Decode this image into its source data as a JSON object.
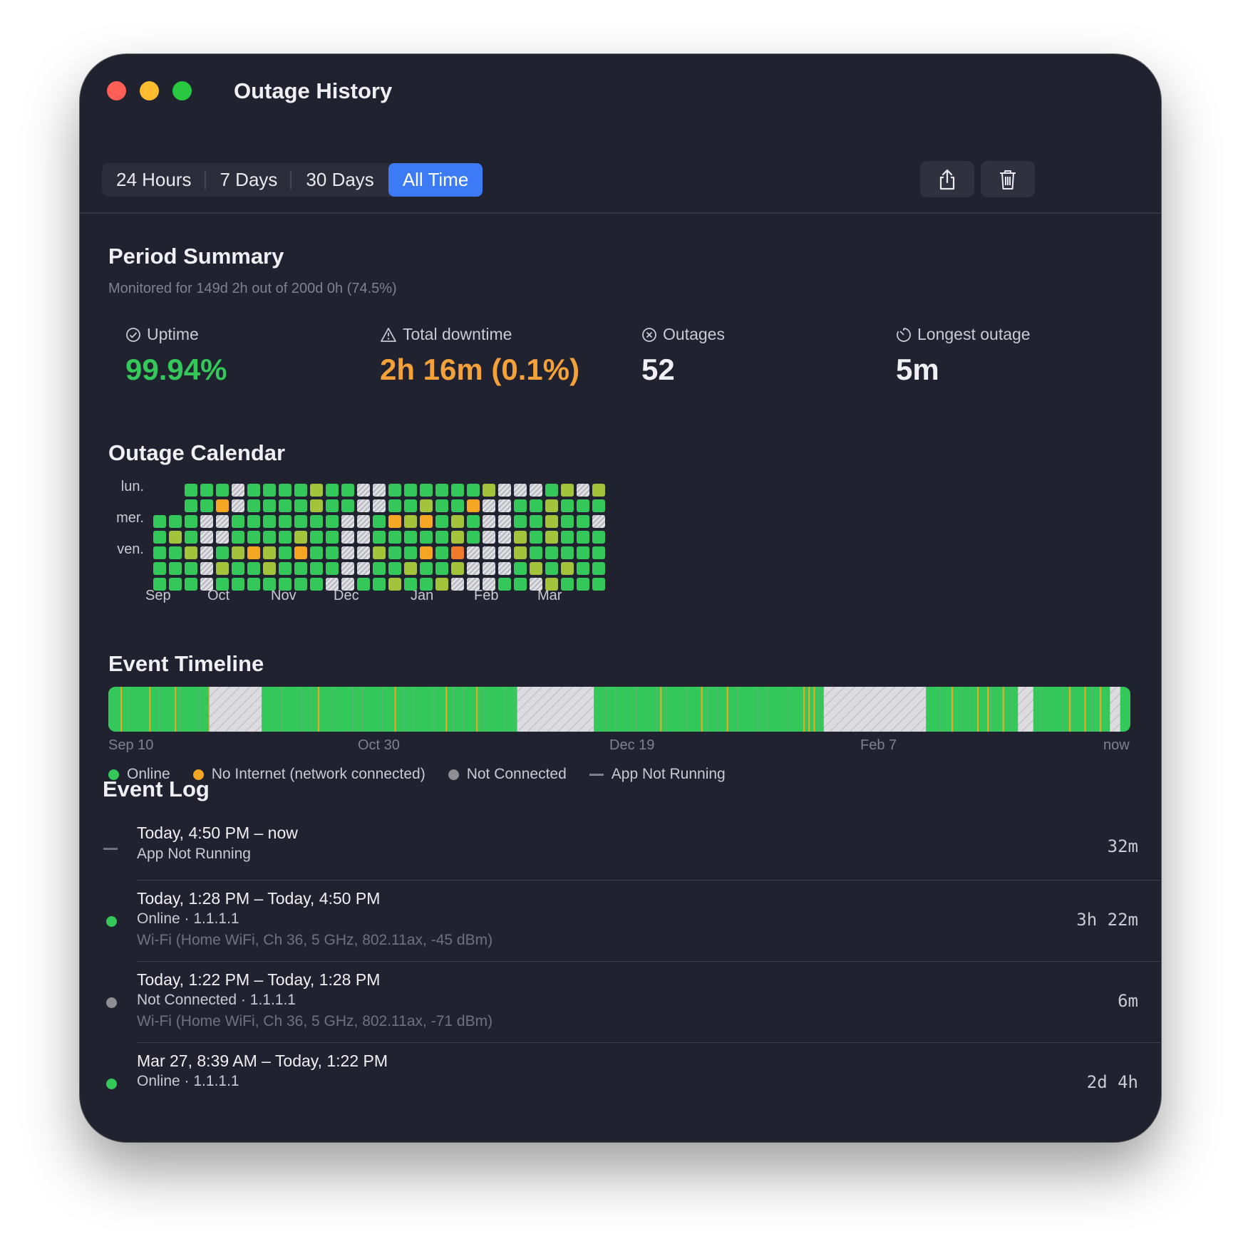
{
  "window": {
    "title": "Outage History"
  },
  "toolbar": {
    "tabs": [
      "24 Hours",
      "7 Days",
      "30 Days",
      "All Time"
    ],
    "active_tab": "All Time",
    "share_icon": "share-icon",
    "trash_icon": "trash-icon"
  },
  "summary": {
    "heading": "Period Summary",
    "monitored": "Monitored for 149d 2h out of 200d 0h (74.5%)",
    "uptime_label": "Uptime",
    "uptime_value": "99.94%",
    "downtime_label": "Total downtime",
    "downtime_value": "2h 16m (0.1%)",
    "outages_label": "Outages",
    "outages_value": "52",
    "longest_label": "Longest outage",
    "longest_value": "5m"
  },
  "calendar": {
    "heading": "Outage Calendar",
    "day_labels": [
      "lun.",
      "mer.",
      "ven."
    ],
    "months": [
      "Sep",
      "Oct",
      "Nov",
      "Dec",
      "Jan",
      "Feb",
      "Mar"
    ],
    "rows": [
      "..GGGWGGGGLGGWWGGGGGGLWWWGLWL",
      "..GGOWGGGGLGGWWGGLGGOWWGGLGGG",
      "GGGWWGGGGGGGWWGOLOGLGWWGGLGGW",
      "GLGWWGGGGLGGWWGGGGGLGWWLGLGGG",
      "GGLWGLOLGOGGWWLGGOGDWWWLGGGGG",
      "GGGWLGGLGGGGWWGGLGGLWWWGLGLGG",
      "GGGWGGGGGGGWWGGLGGLWWWGGWLGGG"
    ],
    "colors": {
      "G": "#34c759",
      "L": "#a3c33a",
      "O": "#f5a623",
      "D": "#f07a2a",
      "W": "#d8d8dc"
    }
  },
  "timeline": {
    "heading": "Event Timeline",
    "axis": [
      "Sep 10",
      "Oct 30",
      "Dec 19",
      "Feb 7",
      "now"
    ],
    "gaps": [
      [
        0.099,
        0.15
      ],
      [
        0.4,
        0.475
      ],
      [
        0.7,
        0.8
      ],
      [
        0.89,
        0.905
      ],
      [
        0.98,
        0.99
      ]
    ],
    "orange_ticks": [
      0.012,
      0.04,
      0.065,
      0.098,
      0.205,
      0.28,
      0.33,
      0.36,
      0.44,
      0.54,
      0.58,
      0.605,
      0.68,
      0.685,
      0.69,
      0.825,
      0.85,
      0.86,
      0.875,
      0.94,
      0.955,
      0.97
    ]
  },
  "legend": {
    "online": "Online",
    "no_internet": "No Internet (network connected)",
    "not_connected": "Not Connected",
    "app_not_running": "App Not Running",
    "online_color": "#34c759",
    "no_internet_color": "#f5a623",
    "not_connected_color": "#8e8e93"
  },
  "log": {
    "heading": "Event Log",
    "events": [
      {
        "title": "Today, 4:50 PM – now",
        "status": "App Not Running",
        "target": "",
        "network": "",
        "duration": "32m"
      },
      {
        "title": "Today, 1:28 PM – Today, 4:50 PM",
        "status": "Online",
        "target": "1.1.1.1",
        "network": "Wi-Fi (Home WiFi, Ch 36, 5 GHz, 802.11ax, -45 dBm)",
        "duration": "3h 22m"
      },
      {
        "title": "Today, 1:22 PM – Today, 1:28 PM",
        "status": "Not Connected",
        "target": "1.1.1.1",
        "network": "Wi-Fi (Home WiFi, Ch 36, 5 GHz, 802.11ax, -71 dBm)",
        "duration": "6m"
      },
      {
        "title": "Mar 27, 8:39 AM – Today, 1:22 PM",
        "status": "Online",
        "target": "1.1.1.1",
        "network": "",
        "duration": "2d 4h"
      }
    ]
  }
}
